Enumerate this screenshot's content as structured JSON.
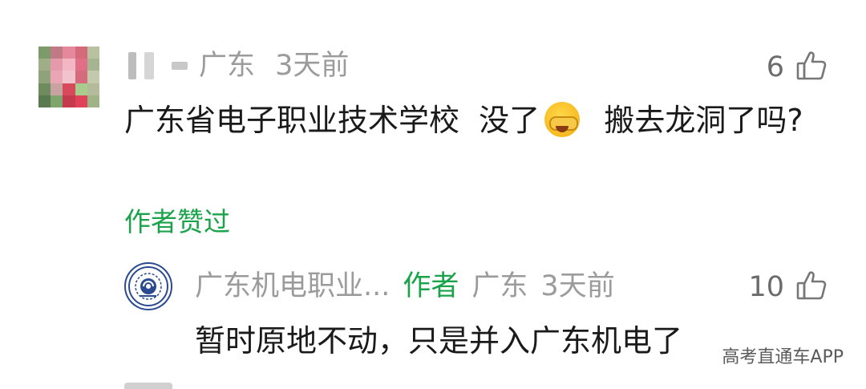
{
  "comment": {
    "username_hidden": true,
    "location": "广东",
    "time": "3天前",
    "likes": "6",
    "text_part1": "广东省电子职业技术学校  没了",
    "emoji_icon": "face-with-tears-emoji",
    "text_part2": "  搬去龙洞了吗?",
    "author_liked": "作者赞过"
  },
  "reply": {
    "username": "广东机电职业...",
    "author_tag": "作者",
    "location": "广东",
    "time": "3天前",
    "likes": "10",
    "text": "暂时原地不动，只是并入广东机电了"
  },
  "watermark": "高考直通车APP",
  "colors": {
    "green": "#1aa34a",
    "meta_gray": "#9b9b9b"
  }
}
